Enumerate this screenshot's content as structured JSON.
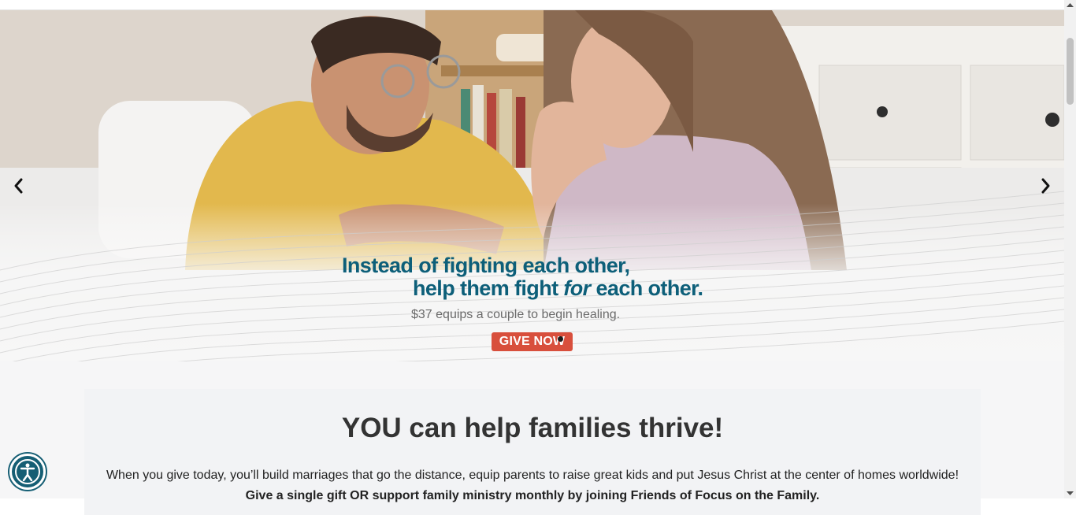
{
  "hero": {
    "headline_line1": "Instead of fighting each other,",
    "headline_line2_pre": "help them fight ",
    "headline_line2_em": "for",
    "headline_line2_post": " each other.",
    "subline": "$37 equips a couple to begin healing.",
    "cta_label": "GIVE NOW",
    "prev_icon": "chevron-left-icon",
    "next_icon": "chevron-right-icon",
    "headline_color": "#0d5f79",
    "cta_color": "#d84f3c"
  },
  "main": {
    "title": "YOU can help families thrive!",
    "body": "When you give today, you’ll build marriages that go the distance, equip parents to raise great kids and put Jesus Christ at the center of homes worldwide!",
    "body_bold": "Give a single gift OR support family ministry monthly by joining Friends of Focus on the Family."
  },
  "accessibility": {
    "icon": "accessibility-icon",
    "color": "#155e74"
  }
}
